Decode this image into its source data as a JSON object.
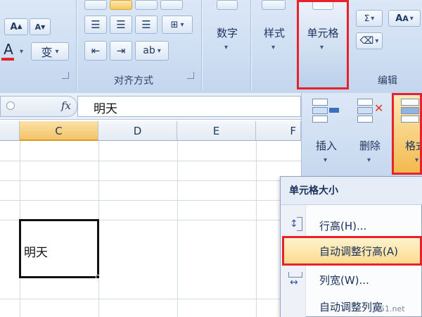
{
  "ribbon": {
    "font_increase_label": "A",
    "font_decrease_label": "A",
    "font_color_label": "A",
    "phonetic_label": "变",
    "align_group_label": "对齐方式",
    "number_label": "数字",
    "style_label": "样式",
    "cells_label": "单元格",
    "edit_group_label": "编辑",
    "find_label": "A"
  },
  "formula_bar": {
    "fx_label": "fx",
    "value": "明天"
  },
  "columns": [
    "C",
    "D",
    "E",
    "F"
  ],
  "selected_cell_text": "明天",
  "cells_panel": {
    "insert_label": "插入",
    "delete_label": "删除",
    "format_label": "格式"
  },
  "menu": {
    "header": "单元格大小",
    "items": [
      {
        "label": "行高(H)..."
      },
      {
        "label": "自动调整行高(A)"
      },
      {
        "label": "列宽(W)..."
      },
      {
        "label": "自动调整列宽"
      }
    ]
  },
  "watermark": "jb51.net",
  "colors": {
    "highlight_red": "#e8222a",
    "active_column": "#f4c466",
    "ribbon_blue": "#cfdff3"
  }
}
